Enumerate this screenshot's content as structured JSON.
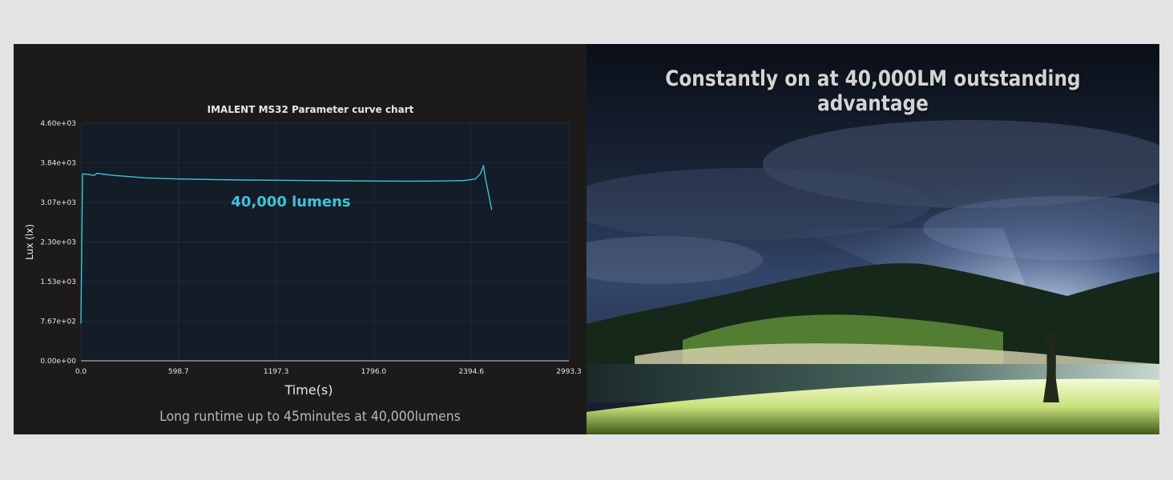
{
  "chart_data": {
    "type": "line",
    "title": "IMALENT MS32 Parameter curve chart",
    "xlabel": "Time(s)",
    "ylabel": "Lux (lx)",
    "x_ticks": [
      "0.0",
      "598.7",
      "1197.3",
      "1796.0",
      "2394.6",
      "2993.3"
    ],
    "x_tick_values": [
      0,
      598.7,
      1197.3,
      1796.0,
      2394.6,
      2993.3
    ],
    "y_ticks": [
      "0.00e+00",
      "7.67e+02",
      "1.53e+03",
      "2.30e+03",
      "3.07e+03",
      "3.84e+03",
      "4.60e+03"
    ],
    "y_tick_values": [
      0,
      767,
      1533,
      2300,
      3067,
      3833,
      4600
    ],
    "xlim": [
      0,
      2993.3
    ],
    "ylim": [
      0,
      4600
    ],
    "grid": true,
    "series": [
      {
        "annotation": "40,000 lumens",
        "color": "#3fc3d6",
        "x": [
          0,
          10,
          20,
          40,
          80,
          100,
          120,
          200,
          400,
          600,
          800,
          1000,
          1200,
          1400,
          1600,
          1800,
          2000,
          2200,
          2350,
          2420,
          2450,
          2470,
          2480,
          2500,
          2520
        ],
        "y": [
          720,
          3620,
          3615,
          3610,
          3590,
          3630,
          3620,
          3590,
          3540,
          3520,
          3510,
          3500,
          3495,
          3490,
          3485,
          3480,
          3478,
          3480,
          3490,
          3520,
          3620,
          3780,
          3550,
          3250,
          2920
        ]
      }
    ]
  },
  "caption": "Long runtime up to 45minutes at 40,000lumens",
  "photo": {
    "headline": "Constantly on at 40,000LM outstanding advantage"
  }
}
